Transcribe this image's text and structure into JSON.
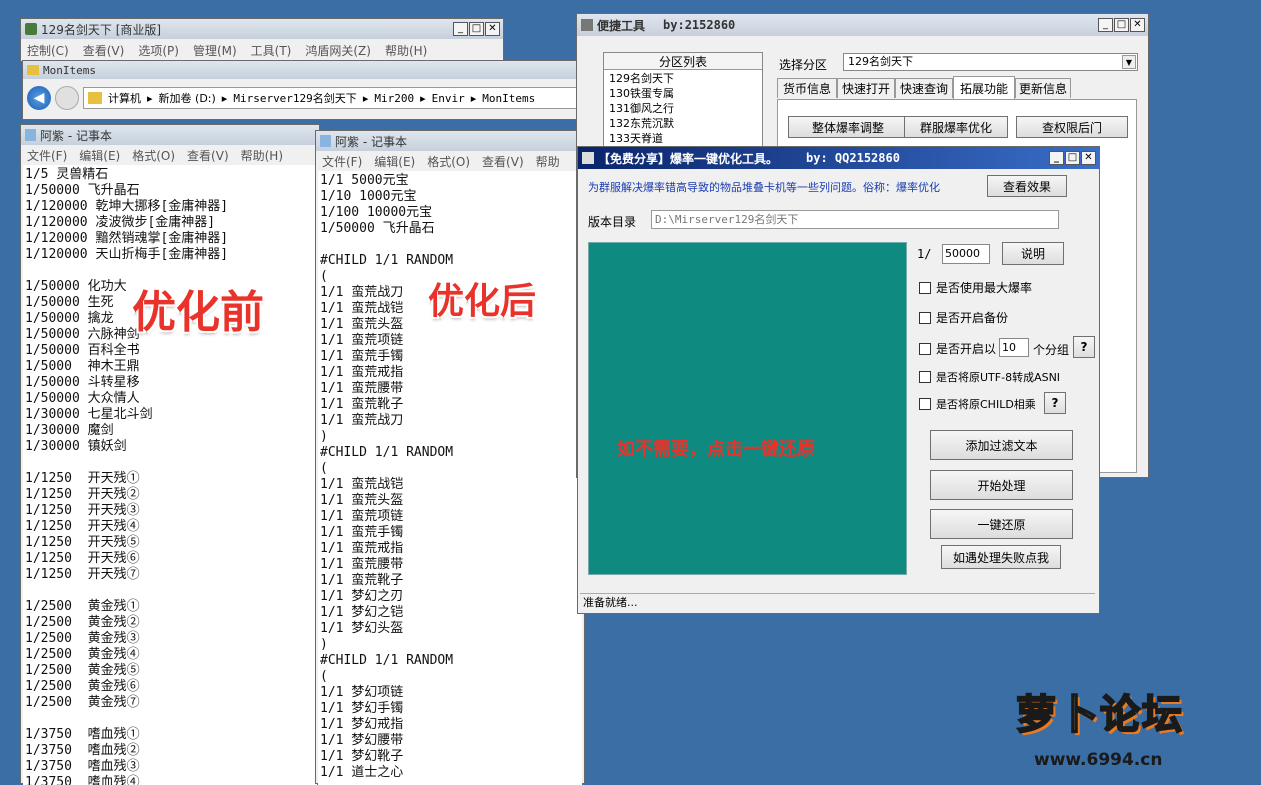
{
  "win_main": {
    "title": "129名剑天下 [商业版]",
    "menu": [
      "控制(C)",
      "查看(V)",
      "选项(P)",
      "管理(M)",
      "工具(T)",
      "鸿盾网关(Z)",
      "帮助(H)"
    ]
  },
  "win_explorer": {
    "title": "MonItems",
    "path": [
      "计算机",
      "新加卷 (D:)",
      "Mirserver129名剑天下",
      "Mir200",
      "Envir",
      "MonItems"
    ]
  },
  "notepad_left": {
    "title": "阿紫 - 记事本",
    "menu": [
      "文件(F)",
      "编辑(E)",
      "格式(O)",
      "查看(V)",
      "帮助(H)"
    ],
    "lines": [
      "1/5 灵兽精石",
      "1/50000 飞升晶石",
      "1/120000 乾坤大挪移[金庸神器]",
      "1/120000 凌波微步[金庸神器]",
      "1/120000 黯然销魂掌[金庸神器]",
      "1/120000 天山折梅手[金庸神器]",
      "",
      "1/50000 化功大",
      "1/50000 生死",
      "1/50000 擒龙",
      "1/50000 六脉神剑",
      "1/50000 百科全书",
      "1/5000  神木王鼎",
      "1/50000 斗转星移",
      "1/50000 大众情人",
      "1/30000 七星北斗剑",
      "1/30000 魔剑",
      "1/30000 镇妖剑",
      "",
      "1/1250  开天残①",
      "1/1250  开天残②",
      "1/1250  开天残③",
      "1/1250  开天残④",
      "1/1250  开天残⑤",
      "1/1250  开天残⑥",
      "1/1250  开天残⑦",
      "",
      "1/2500  黄金残①",
      "1/2500  黄金残②",
      "1/2500  黄金残③",
      "1/2500  黄金残④",
      "1/2500  黄金残⑤",
      "1/2500  黄金残⑥",
      "1/2500  黄金残⑦",
      "",
      "1/3750  嗜血残①",
      "1/3750  嗜血残②",
      "1/3750  嗜血残③",
      "1/3750  嗜血残④"
    ]
  },
  "notepad_right": {
    "title": "阿紫 - 记事本",
    "menu": [
      "文件(F)",
      "编辑(E)",
      "格式(O)",
      "查看(V)",
      "帮助"
    ],
    "lines": [
      "1/1 5000元宝",
      "1/10 1000元宝",
      "1/100 10000元宝",
      "1/50000 飞升晶石",
      "",
      "#CHILD 1/1 RANDOM",
      "(",
      "1/1 蛮荒战刀",
      "1/1 蛮荒战铠",
      "1/1 蛮荒头盔",
      "1/1 蛮荒项链",
      "1/1 蛮荒手镯",
      "1/1 蛮荒戒指",
      "1/1 蛮荒腰带",
      "1/1 蛮荒靴子",
      "1/1 蛮荒战刀",
      ")",
      "#CHILD 1/1 RANDOM",
      "(",
      "1/1 蛮荒战铠",
      "1/1 蛮荒头盔",
      "1/1 蛮荒项链",
      "1/1 蛮荒手镯",
      "1/1 蛮荒戒指",
      "1/1 蛮荒腰带",
      "1/1 蛮荒靴子",
      "1/1 梦幻之刃",
      "1/1 梦幻之铠",
      "1/1 梦幻头盔",
      ")",
      "#CHILD 1/1 RANDOM",
      "(",
      "1/1 梦幻项链",
      "1/1 梦幻手镯",
      "1/1 梦幻戒指",
      "1/1 梦幻腰带",
      "1/1 梦幻靴子",
      "1/1 道士之心"
    ]
  },
  "overlay": {
    "before": "优化前",
    "after": "优化后"
  },
  "quick_tool": {
    "title": "便捷工具",
    "by": "by:2152860",
    "list_header": "分区列表",
    "list_items": [
      "129名剑天下",
      "130铁蛋专属",
      "131御风之行",
      "132东荒沉默",
      "133天脊道"
    ],
    "select_label": "选择分区",
    "select_value": "129名剑天下",
    "tabs": [
      "货币信息",
      "快速打开",
      "快速查询",
      "拓展功能",
      "更新信息"
    ],
    "buttons": [
      "整体爆率调整",
      "群服爆率优化",
      "查权限后门"
    ]
  },
  "opt_tool": {
    "title": "【免费分享】爆率一键优化工具。",
    "by": "by: QQ2152860",
    "desc": "为群服解决爆率错高导致的物品堆叠卡机等一些列问题。俗称：爆率优化",
    "view_effect": "查看效果",
    "dir_label": "版本目录",
    "dir_value": "D:\\Mirserver129名剑天下",
    "ratio_prefix": "1/",
    "ratio_value": "50000",
    "explain_btn": "说明",
    "checks": [
      "是否使用最大爆率",
      "是否开启备份",
      "是否开启以",
      "是否将原UTF-8转成ASNI",
      "是否将原CHILD相乘"
    ],
    "group_value": "10",
    "group_suffix": "个分组",
    "help": "?",
    "panel_text": "如不需要，点击一键还原",
    "actions": [
      "添加过滤文本",
      "开始处理",
      "一键还原",
      "如遇处理失败点我"
    ],
    "status": "准备就绪..."
  },
  "watermark": {
    "brand": "萝卜论坛",
    "url": "www.6994.cn"
  },
  "colors": {
    "desktop": "#3a6ea5",
    "panel": "#0f8a80",
    "accent_red": "#e8322a",
    "title_dark": "#0a246a"
  }
}
